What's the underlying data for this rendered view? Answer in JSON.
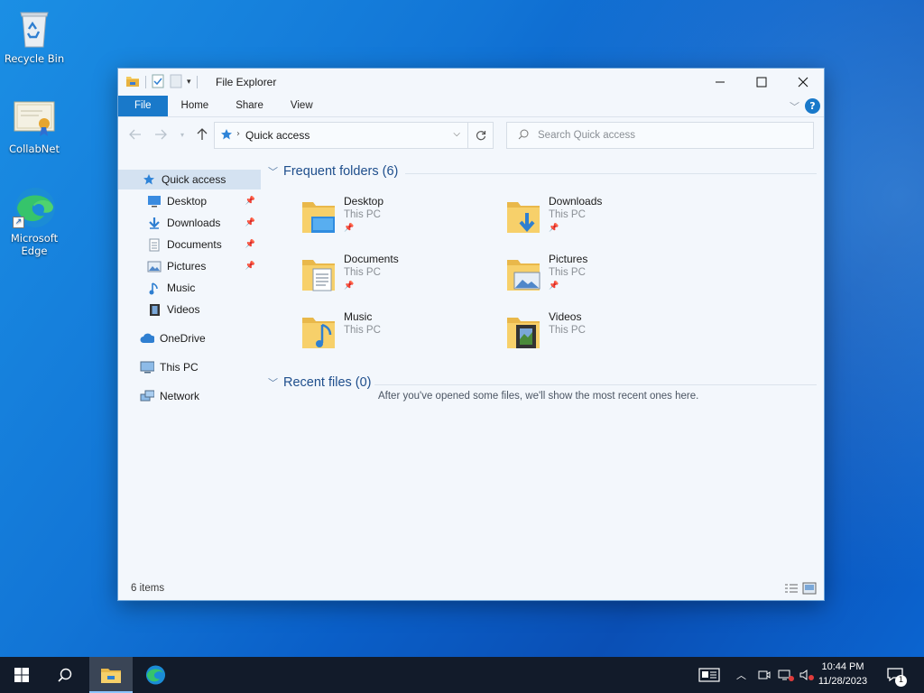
{
  "desktop": {
    "icons": [
      {
        "label": "Recycle Bin"
      },
      {
        "label": "CollabNet"
      },
      {
        "label": "Microsoft Edge"
      }
    ]
  },
  "window": {
    "title": "File Explorer",
    "tabs": [
      "File",
      "Home",
      "Share",
      "View"
    ],
    "address": "Quick access",
    "search_placeholder": "Search Quick access",
    "help": "?"
  },
  "navpane": {
    "items": [
      {
        "label": "Quick access",
        "icon": "star-icon",
        "selected": true
      },
      {
        "label": "Desktop",
        "icon": "desktop-icon",
        "pinned": true
      },
      {
        "label": "Downloads",
        "icon": "download-arrow-icon",
        "pinned": true
      },
      {
        "label": "Documents",
        "icon": "document-icon",
        "pinned": true
      },
      {
        "label": "Pictures",
        "icon": "picture-icon",
        "pinned": true
      },
      {
        "label": "Music",
        "icon": "music-note-icon"
      },
      {
        "label": "Videos",
        "icon": "film-icon"
      },
      {
        "label": "OneDrive",
        "icon": "cloud-icon"
      },
      {
        "label": "This PC",
        "icon": "monitor-icon"
      },
      {
        "label": "Network",
        "icon": "network-icon"
      }
    ]
  },
  "content": {
    "frequent_header": "Frequent folders (6)",
    "recent_header": "Recent files (0)",
    "folders": [
      {
        "name": "Desktop",
        "location": "This PC",
        "pinned": true
      },
      {
        "name": "Downloads",
        "location": "This PC",
        "pinned": true
      },
      {
        "name": "Documents",
        "location": "This PC",
        "pinned": true
      },
      {
        "name": "Pictures",
        "location": "This PC",
        "pinned": true
      },
      {
        "name": "Music",
        "location": "This PC",
        "pinned": false
      },
      {
        "name": "Videos",
        "location": "This PC",
        "pinned": false
      }
    ],
    "empty_message": "After you've opened some files, we'll show the most recent ones here."
  },
  "status": {
    "items_text": "6 items"
  },
  "taskbar": {
    "time": "10:44 PM",
    "date": "11/28/2023",
    "notification_count": "1"
  },
  "colors": {
    "accent": "#1979ca",
    "taskbar": "#121b2a",
    "folder_yellow": "#f4c95b"
  }
}
